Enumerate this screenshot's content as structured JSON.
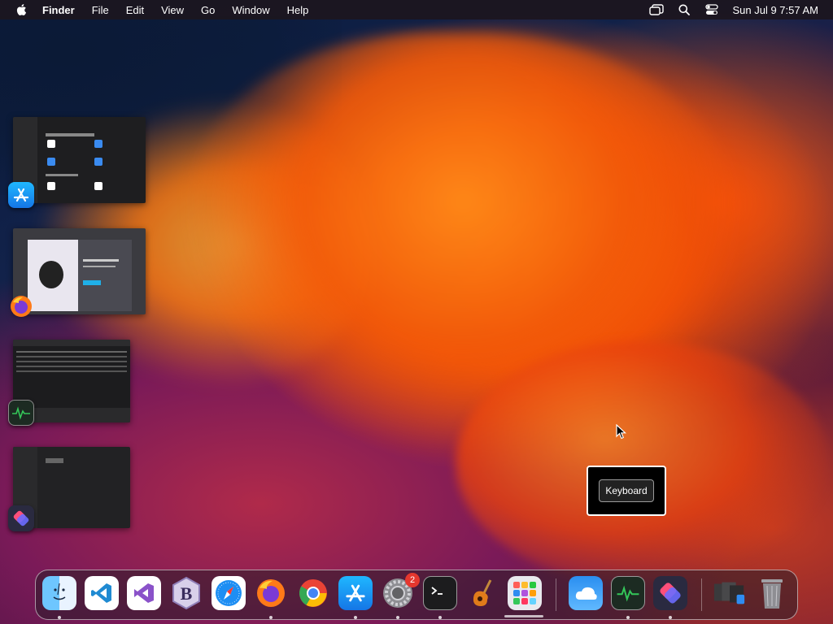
{
  "menubar": {
    "apple_icon": "apple-logo-icon",
    "app_name": "Finder",
    "menus": [
      "File",
      "Edit",
      "View",
      "Go",
      "Window",
      "Help"
    ],
    "status_icons": [
      "stage-manager-icon",
      "spotlight-search-icon",
      "control-center-icon"
    ],
    "clock": "Sun Jul 9  7:57 AM"
  },
  "stage_manager": [
    {
      "app": "App Store",
      "icon": "app-store-icon"
    },
    {
      "app": "Firefox",
      "icon": "firefox-icon"
    },
    {
      "app": "Activity Monitor",
      "icon": "activity-monitor-icon"
    },
    {
      "app": "Shortcuts",
      "icon": "shortcuts-icon"
    }
  ],
  "tooltip": {
    "key_label": "Keyboard"
  },
  "dock": {
    "items": [
      {
        "name": "Finder",
        "icon": "finder-icon",
        "running": true
      },
      {
        "name": "Visual Studio Code",
        "icon": "vscode-icon",
        "running": false
      },
      {
        "name": "Visual Studio",
        "icon": "visual-studio-icon",
        "running": false
      },
      {
        "name": "BBEdit",
        "icon": "bbedit-icon",
        "running": false
      },
      {
        "name": "Safari",
        "icon": "safari-icon",
        "running": false
      },
      {
        "name": "Firefox",
        "icon": "firefox-icon",
        "running": true
      },
      {
        "name": "Google Chrome",
        "icon": "chrome-icon",
        "running": false
      },
      {
        "name": "App Store",
        "icon": "app-store-icon",
        "running": true
      },
      {
        "name": "System Settings",
        "icon": "system-settings-icon",
        "running": true,
        "badge": "2"
      },
      {
        "name": "Terminal",
        "icon": "terminal-icon",
        "running": true
      },
      {
        "name": "GarageBand",
        "icon": "garageband-icon",
        "running": false
      },
      {
        "name": "Launchpad",
        "icon": "launchpad-icon",
        "running": false
      },
      {
        "name": "Weather",
        "icon": "weather-icon",
        "running": false
      },
      {
        "name": "Activity Monitor",
        "icon": "activity-monitor-icon",
        "running": true
      },
      {
        "name": "Shortcuts",
        "icon": "shortcuts-icon",
        "running": true
      },
      {
        "name": "Downloads Stack",
        "icon": "downloads-stack-icon",
        "running": false
      },
      {
        "name": "Trash",
        "icon": "trash-icon",
        "running": false
      }
    ]
  }
}
